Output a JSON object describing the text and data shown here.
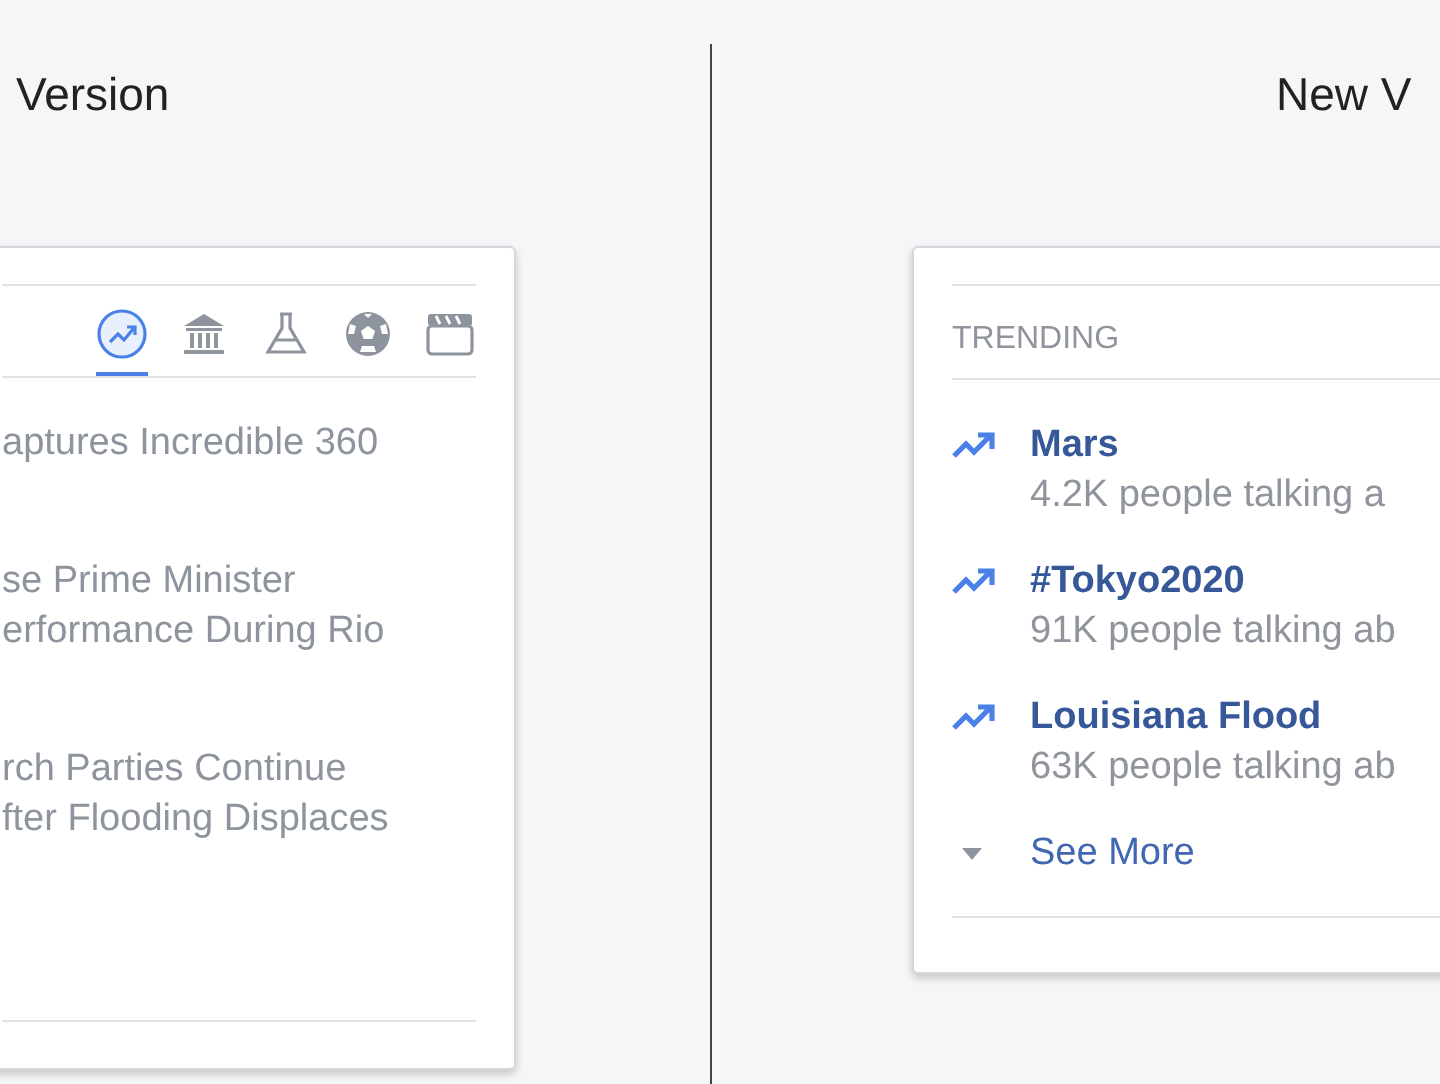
{
  "old_version": {
    "heading": "Version",
    "tabs": [
      {
        "kind": "trending",
        "selected": true
      },
      {
        "kind": "politics",
        "selected": false
      },
      {
        "kind": "science",
        "selected": false
      },
      {
        "kind": "sports",
        "selected": false
      },
      {
        "kind": "entertainment",
        "selected": false
      }
    ],
    "headlines": [
      {
        "lines": [
          "aptures Incredible 360"
        ]
      },
      {
        "lines": [
          "se Prime Minister",
          "erformance During Rio"
        ]
      },
      {
        "lines": [
          "rch Parties Continue",
          "fter Flooding Displaces"
        ]
      }
    ]
  },
  "new_version": {
    "heading": "New V",
    "section_title": "TRENDING",
    "topics": [
      {
        "title": "Mars",
        "subtitle": "4.2K people talking a"
      },
      {
        "title": "#Tokyo2020",
        "subtitle": "91K people talking ab"
      },
      {
        "title": "Louisiana Flood",
        "subtitle": "63K people talking ab"
      }
    ],
    "see_more": "See More"
  }
}
